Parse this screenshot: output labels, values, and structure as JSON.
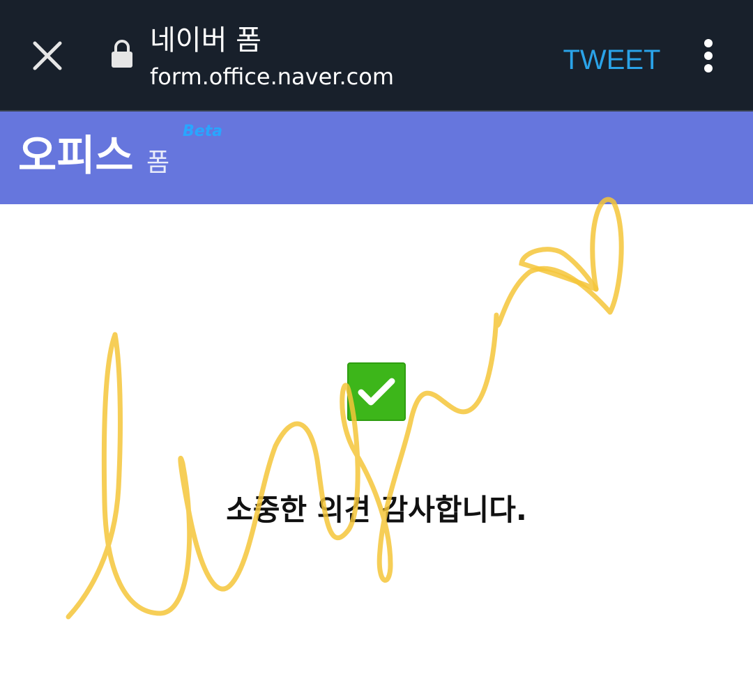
{
  "browser": {
    "title": "네이버 폼",
    "url": "form.office.naver.com",
    "action_label": "TWEET",
    "close_icon": "close-icon",
    "lock_icon": "lock-icon",
    "more_icon": "more-vert-icon"
  },
  "brand": {
    "main": "오피스",
    "sub": "폼",
    "badge": "Beta",
    "color": "#6676dd"
  },
  "confirmation": {
    "icon": "checkmark-icon",
    "message": "소중한 의견 감사합니다.",
    "check_color": "#3db61a"
  },
  "colors": {
    "toolbar": "#18202b",
    "accent": "#2aa3e8",
    "scribble": "#f4c63a"
  }
}
